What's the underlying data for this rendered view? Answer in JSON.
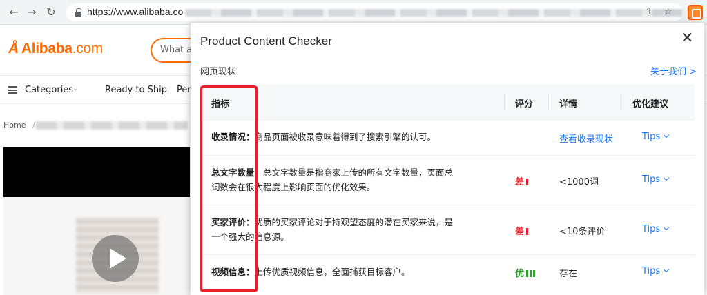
{
  "browser": {
    "url_visible": "https://www.alibaba.co",
    "back_icon": "arrow-left-icon",
    "forward_icon": "arrow-right-icon",
    "reload_icon": "reload-icon"
  },
  "page": {
    "logo_text": "Alibaba",
    "logo_suffix": ".com",
    "search_placeholder": "What ar",
    "categories_label": "Categories",
    "nav_ready_to_ship": "Ready to Ship",
    "nav_partial": "Per",
    "breadcrumb_home": "Home",
    "breadcrumb_sep": "/"
  },
  "popup": {
    "title": "Product Content Checker",
    "status_label": "网页现状",
    "about_link": "关于我们 >",
    "columns": {
      "metric": "指标",
      "score": "评分",
      "detail": "详情",
      "suggest": "优化建议"
    },
    "rows": [
      {
        "label": "收录情况：",
        "text": "商品页面被收录意味着得到了搜索引擎的认可。",
        "rating": "",
        "rating_color": "",
        "bars": 0,
        "detail": "查看收录现状",
        "detail_is_link": true,
        "tips": "Tips"
      },
      {
        "label": "总文字数量：",
        "text": "总文字数量是指商家上传的所有文字数量，页面总词数会在很大程度上影响页面的优化效果。",
        "line1": "总文字数量是指商家上传的所有文字数量，页面总",
        "line2": "词数会在很大程度上影响页面的优化效果。",
        "rating": "差",
        "rating_color": "#e8202a",
        "bars": 1,
        "detail": "<1000词",
        "detail_is_link": false,
        "tips": "Tips"
      },
      {
        "label": "买家评价：",
        "line1": "优质的买家评论对于持观望态度的潜在买家来说，是",
        "line2": "一个强大的信息源。",
        "rating": "差",
        "rating_color": "#e8202a",
        "bars": 1,
        "detail": "<10条评价",
        "detail_is_link": false,
        "tips": "Tips"
      },
      {
        "label": "视频信息：",
        "text": "上传优质视频信息，全面捕获目标客户。",
        "rating": "优",
        "rating_color": "#2ca02c",
        "bars": 3,
        "detail": "存在",
        "detail_is_link": false,
        "tips": "Tips"
      }
    ]
  }
}
